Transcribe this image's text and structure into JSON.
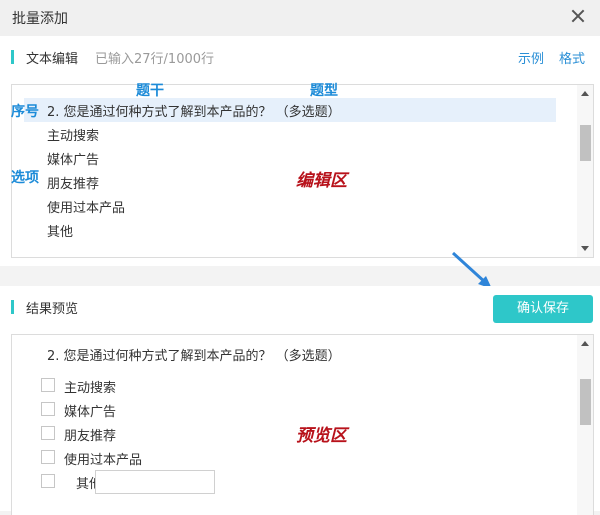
{
  "dialog": {
    "title": "批量添加"
  },
  "editor": {
    "section_title": "文本编辑",
    "count_text": "已输入27行/1000行",
    "example_link": "示例",
    "format_link": "格式",
    "lines": [
      "2. 您是通过何种方式了解到本产品的？ （多选题）",
      "主动搜索",
      "媒体广告",
      "朋友推荐",
      "使用过本产品",
      "其他"
    ]
  },
  "annotations": {
    "stem": "题干",
    "type": "题型",
    "number": "序号",
    "options": "选项",
    "edit_zone": "编辑区",
    "preview_zone": "预览区"
  },
  "preview": {
    "section_title": "结果预览",
    "save_button": "确认保存",
    "question": "2. 您是通过何种方式了解到本产品的？ （多选题）",
    "options": [
      "主动搜索",
      "媒体广告",
      "朋友推荐",
      "使用过本产品",
      "其他"
    ]
  }
}
